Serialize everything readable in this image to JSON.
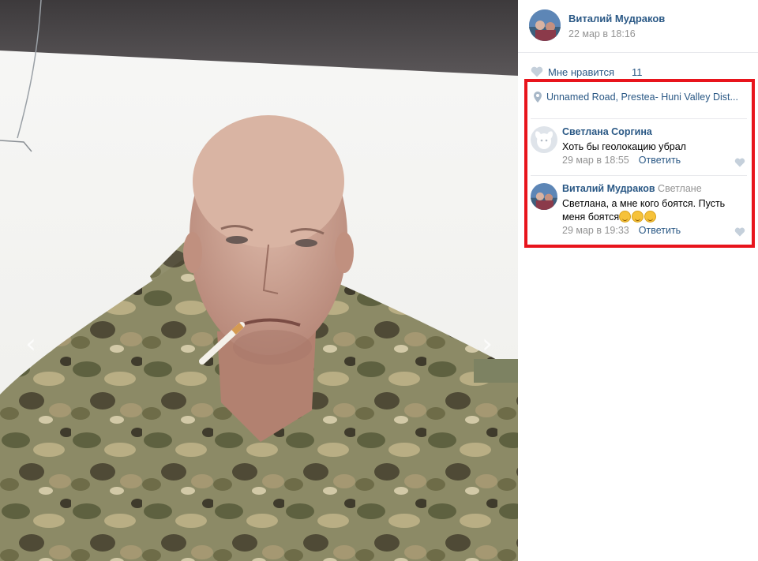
{
  "photo": {
    "alt_subject": "selfie photo",
    "nav_prev": "‹",
    "nav_next": "›"
  },
  "author": {
    "name": "Виталий Мудраков",
    "date": "22 мар в 18:16"
  },
  "likes": {
    "label": "Мне нравится",
    "count": "11"
  },
  "location": {
    "text": "Unnamed Road, Prestea- Huni Valley Dist..."
  },
  "comments": [
    {
      "author": "Светлана Соргина",
      "reply_to": "",
      "text": "Хоть бы геолокацию убрал",
      "date": "29 мар в 18:55",
      "reply_label": "Ответить"
    },
    {
      "author": "Виталий Мудраков",
      "reply_to": "Светлане",
      "text": "Светлана, а мне кого боятся. Пусть меня боятся",
      "emoji_count": 3,
      "date": "29 мар в 19:33",
      "reply_label": "Ответить"
    }
  ],
  "colors": {
    "link": "#2a5885",
    "muted": "#939393",
    "highlight": "#e8141c",
    "separator": "#e7e8ec"
  }
}
